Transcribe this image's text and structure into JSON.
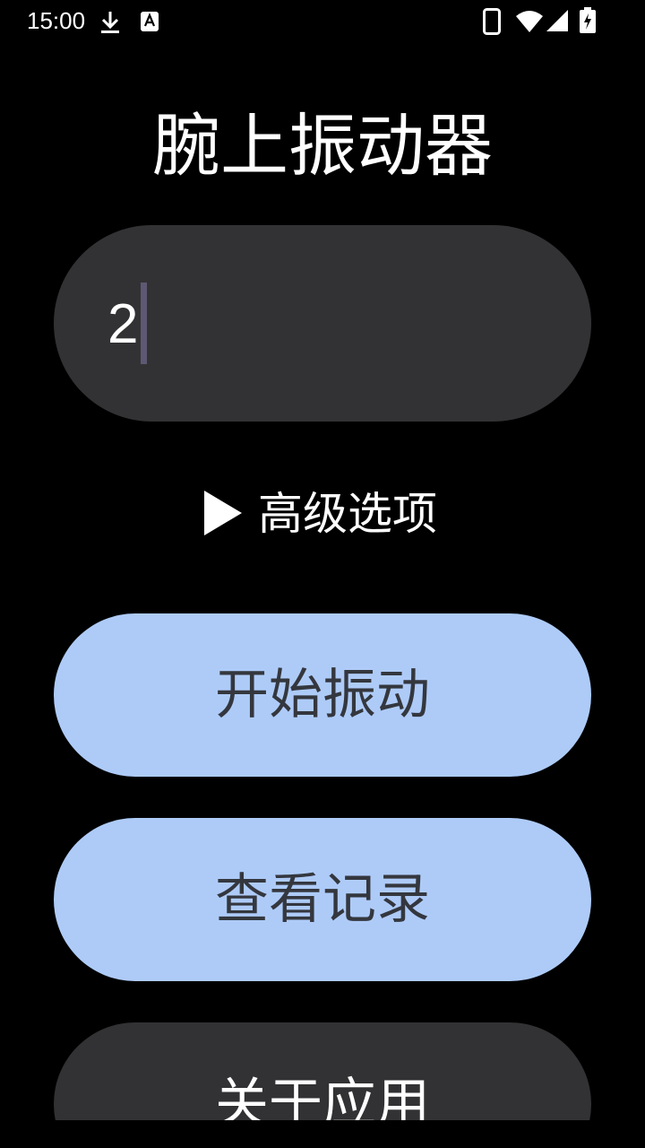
{
  "status_bar": {
    "time": "15:00",
    "icons": [
      "download-icon",
      "keyboard-a-icon",
      "phone-icon",
      "wifi-icon",
      "signal-icon",
      "battery-charging-icon"
    ]
  },
  "app": {
    "title": "腕上振动器"
  },
  "input": {
    "value": "2"
  },
  "advanced": {
    "label": "高级选项",
    "icon": "play-triangle-icon"
  },
  "buttons": {
    "start": "开始振动",
    "history": "查看记录",
    "about": "关于应用"
  },
  "colors": {
    "background": "#000000",
    "surface": "#323234",
    "primary_button": "#aecbf8",
    "primary_text": "#34373e",
    "caret": "#5e5873"
  }
}
